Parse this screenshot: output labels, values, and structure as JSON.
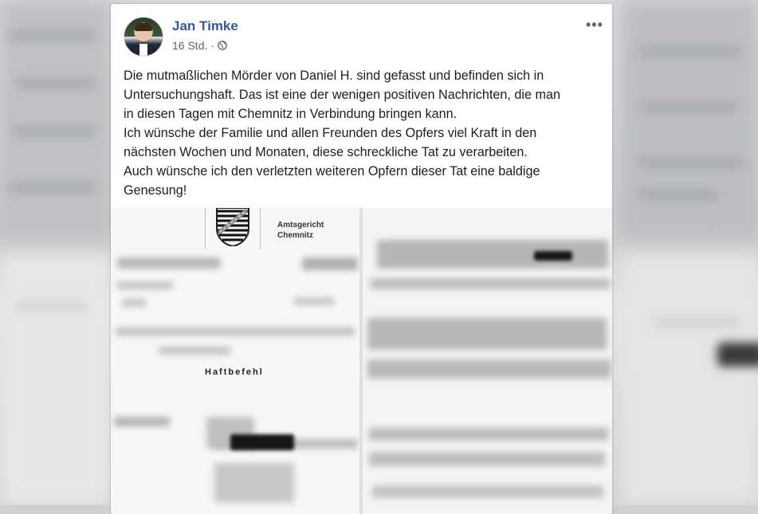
{
  "post": {
    "author_name": "Jan Timke",
    "timestamp": "16 Std.",
    "separator": "·",
    "more_label": "•••",
    "message_lines": [
      "Die mutmaßlichen Mörder von Daniel H. sind gefasst und befinden sich in",
      "Untersuchungshaft. Das ist eine der wenigen positiven Nachrichten, die man",
      "in diesen Tagen mit Chemnitz in Verbindung bringen kann.",
      "Ich wünsche der Familie und allen Freunden des Opfers viel Kraft in den",
      "nächsten Wochen und Monaten, diese schreckliche Tat zu verarbeiten.",
      "Auch wünsche ich den verletzten weiteren Opfern dieser Tat eine baldige",
      "Genesung!"
    ]
  },
  "document": {
    "court_line_1": "Amtsgericht",
    "court_line_2": "Chemnitz",
    "title": "Haftbefehl"
  },
  "icons": {
    "audience": "globe-icon",
    "options": "more-options-icon"
  },
  "colors": {
    "author_link": "#385898",
    "meta_text": "#606770",
    "body_text": "#1c1e21",
    "card_bg": "#ffffff"
  }
}
